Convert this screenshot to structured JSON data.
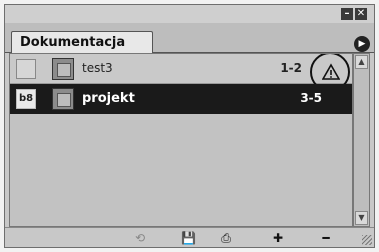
{
  "window": {
    "minimize_glyph": "–",
    "close_glyph": "✕"
  },
  "panel": {
    "tab_label": "Dokumentacja",
    "menu_glyph": "▶"
  },
  "documents": [
    {
      "name": "test3",
      "pages": "1-2",
      "link_glyph": "",
      "status": "warning",
      "selected": false
    },
    {
      "name": "projekt",
      "pages": "3-5",
      "link_glyph": "b8",
      "status": "",
      "selected": true
    }
  ],
  "footer": {
    "icons": [
      "sync-icon",
      "save-icon",
      "print-icon",
      "add-icon",
      "remove-icon"
    ],
    "glyphs": [
      "⟲",
      "💾",
      "⎙",
      "✚",
      "━"
    ]
  },
  "colors": {
    "panel_bg": "#c8c8c8",
    "selected_row_bg": "#1a1a1a",
    "selected_row_text": "#ffffff",
    "warning_outline": "#111111"
  }
}
